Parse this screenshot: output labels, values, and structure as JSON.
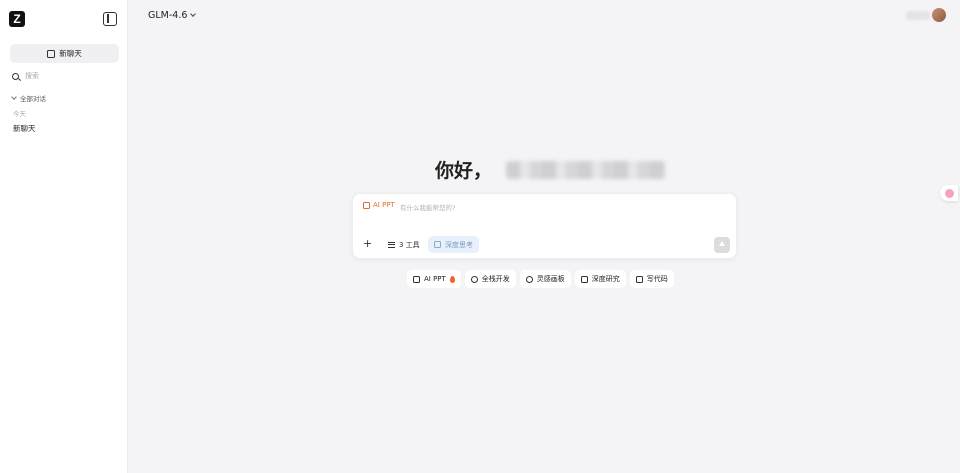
{
  "sidebar": {
    "logo_letter": "Z",
    "new_chat_label": "新聊天",
    "search_placeholder": "搜索",
    "filter_label": "全部对话",
    "section_today": "今天",
    "history": [
      {
        "label": "新聊天"
      }
    ]
  },
  "header": {
    "model_name": "GLM-4.6"
  },
  "main": {
    "greeting": "你好，",
    "input": {
      "tag_label": "AI PPT",
      "placeholder": "有什么我能帮您的?",
      "tools_label": "3 工具",
      "deep_think_label": "深度思考"
    },
    "quick_actions": [
      {
        "label": "AI PPT",
        "icon": "presentation-icon"
      },
      {
        "label": "全栈开发",
        "icon": "puzzle-icon"
      },
      {
        "label": "灵感画板",
        "icon": "sparkle-icon"
      },
      {
        "label": "深度研究",
        "icon": "research-icon"
      },
      {
        "label": "写代码",
        "icon": "image-code-icon"
      }
    ]
  },
  "colors": {
    "accent_orange": "#e0702a",
    "deep_think_bg": "#e7f0fb",
    "background": "#f4f4f6"
  }
}
